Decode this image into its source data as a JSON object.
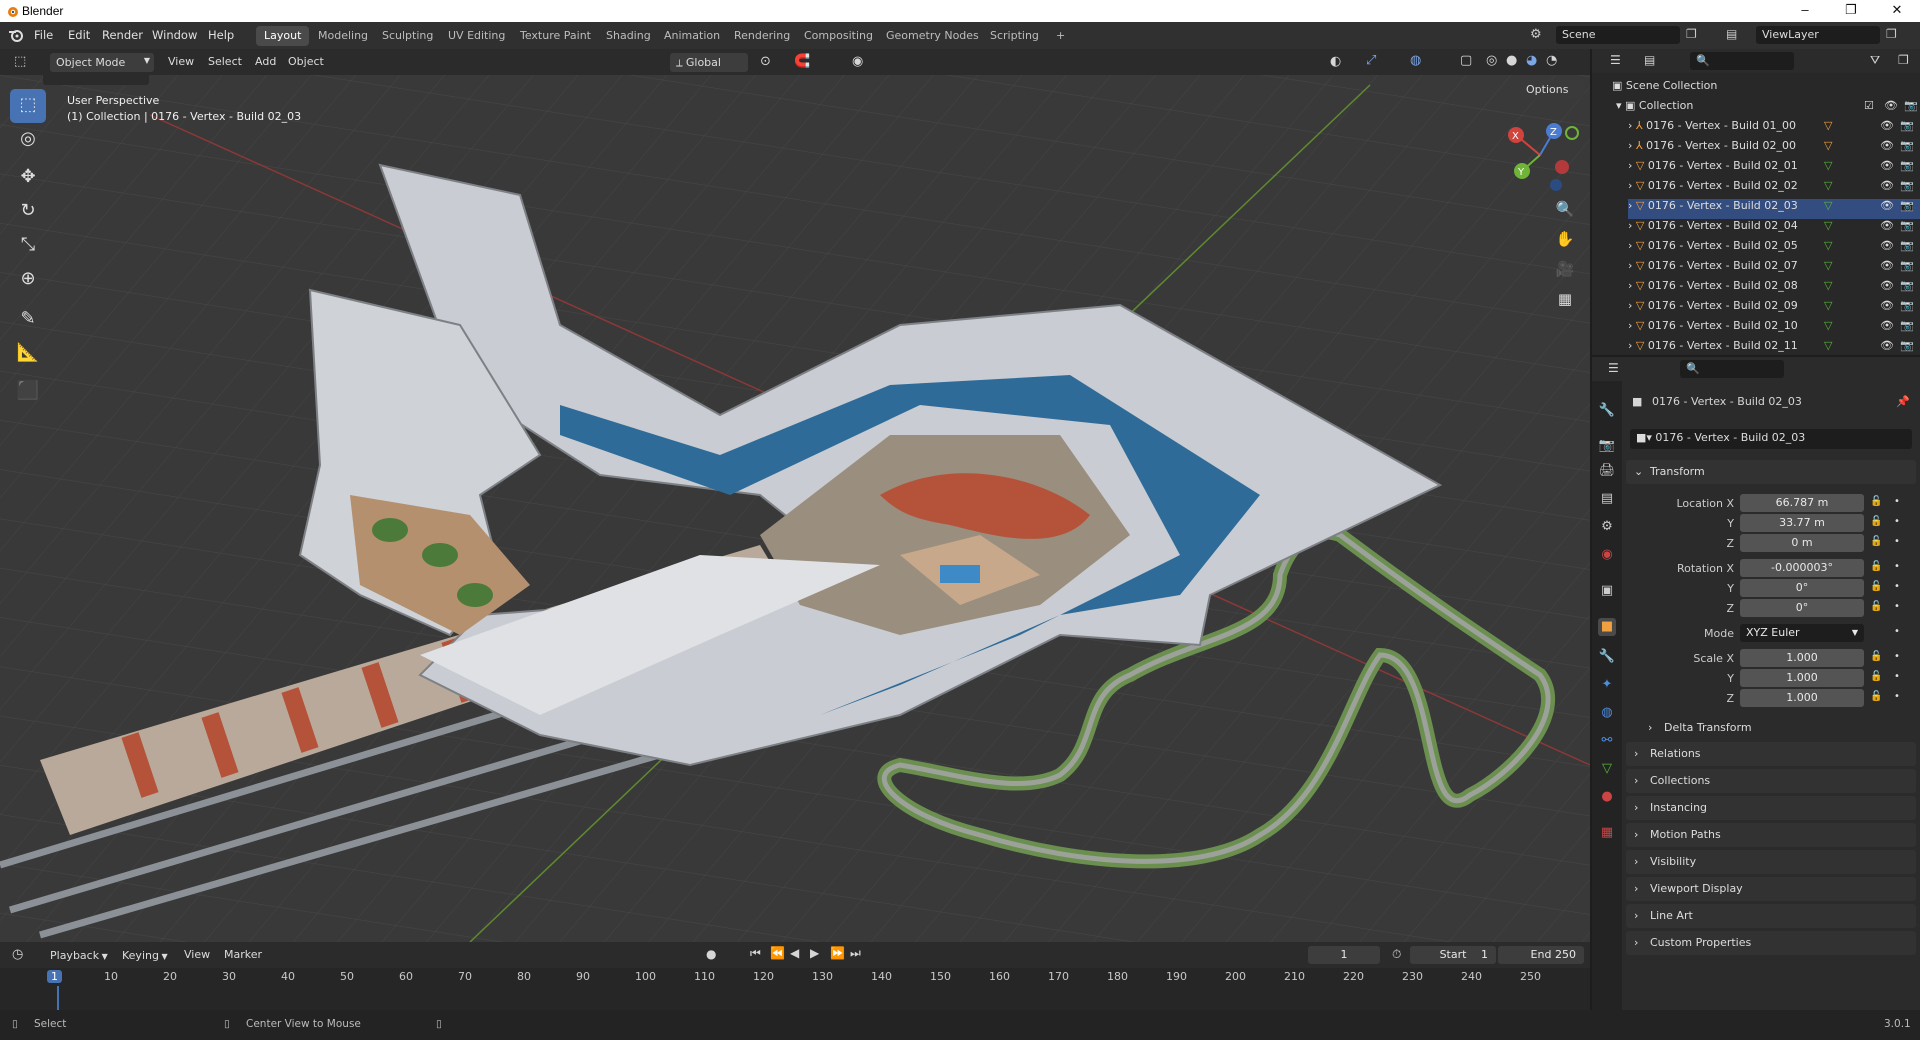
{
  "titlebar": {
    "title": "Blender",
    "min": "–",
    "max": "❐",
    "close": "✕"
  },
  "menu": [
    "File",
    "Edit",
    "Render",
    "Window",
    "Help"
  ],
  "workspaces": [
    "Layout",
    "Modeling",
    "Sculpting",
    "UV Editing",
    "Texture Paint",
    "Shading",
    "Animation",
    "Rendering",
    "Compositing",
    "Geometry Nodes",
    "Scripting",
    "+"
  ],
  "scene": "Scene",
  "viewlayer": "ViewLayer",
  "viewport": {
    "mode": "Object Mode",
    "menus": [
      "View",
      "Select",
      "Add",
      "Object"
    ],
    "orientation": "Global",
    "options": "Options",
    "persp": "User Perspective",
    "collection_info": "(1) Collection | 0176 - Vertex - Build 02_03"
  },
  "outliner": {
    "root": "Scene Collection",
    "collection": "Collection",
    "items": [
      "0176 - Vertex - Build 01_00",
      "0176 - Vertex - Build 02_00",
      "0176 - Vertex - Build 02_01",
      "0176 - Vertex - Build 02_02",
      "0176 - Vertex - Build 02_03",
      "0176 - Vertex - Build 02_04",
      "0176 - Vertex - Build 02_05",
      "0176 - Vertex - Build 02_07",
      "0176 - Vertex - Build 02_08",
      "0176 - Vertex - Build 02_09",
      "0176 - Vertex - Build 02_10",
      "0176 - Vertex - Build 02_11"
    ]
  },
  "properties": {
    "object_name": "0176 - Vertex - Build 02_03",
    "name_field": "0176 - Vertex - Build 02_03",
    "transform": "Transform",
    "location_label": "Location X",
    "loc_x": "66.787 m",
    "loc_y": "33.77 m",
    "loc_z": "0 m",
    "rotation_label": "Rotation X",
    "rot_x": "-0.000003°",
    "rot_y": "0°",
    "rot_z": "0°",
    "mode_label": "Mode",
    "mode": "XYZ Euler",
    "scale_label": "Scale X",
    "scale_x": "1.000",
    "scale_y": "1.000",
    "scale_z": "1.000",
    "y": "Y",
    "z": "Z",
    "delta": "Delta Transform",
    "panels": [
      "Relations",
      "Collections",
      "Instancing",
      "Motion Paths",
      "Visibility",
      "Viewport Display",
      "Line Art",
      "Custom Properties"
    ]
  },
  "timeline": {
    "menus": [
      "Playback",
      "Keying",
      "View",
      "Marker"
    ],
    "current": "1",
    "start_label": "Start",
    "start": "1",
    "end_label": "End",
    "end": "250",
    "ticks": [
      "1",
      "10",
      "20",
      "30",
      "40",
      "50",
      "60",
      "70",
      "80",
      "90",
      "100",
      "110",
      "120",
      "130",
      "140",
      "150",
      "160",
      "170",
      "180",
      "190",
      "200",
      "210",
      "220",
      "230",
      "240",
      "250"
    ]
  },
  "status": {
    "select": "Select",
    "center": "Center View to Mouse",
    "version": "3.0.1"
  },
  "colors": {
    "accent": "#4772b3",
    "panel": "#2b2b2b",
    "viewport": "#393939"
  }
}
